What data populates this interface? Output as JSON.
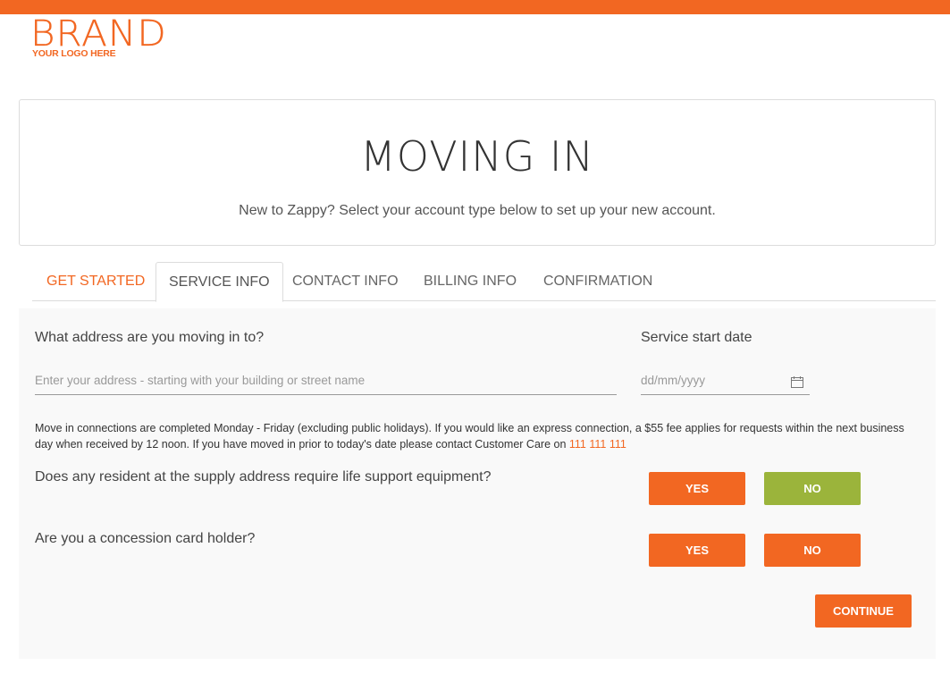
{
  "brand": {
    "name": "BRAND",
    "tagline": "YOUR LOGO HERE",
    "accent_color": "#f26722"
  },
  "hero": {
    "title": "MOVING IN",
    "subtitle": "New to Zappy? Select your account type below to set up your new account."
  },
  "tabs": [
    {
      "label": "GET STARTED",
      "state": "completed"
    },
    {
      "label": "SERVICE INFO",
      "state": "active"
    },
    {
      "label": "CONTACT INFO",
      "state": "pending"
    },
    {
      "label": "BILLING INFO",
      "state": "pending"
    },
    {
      "label": "CONFIRMATION",
      "state": "pending"
    }
  ],
  "form": {
    "address": {
      "label": "What address are you moving in to?",
      "value": "",
      "placeholder": "Enter your address - starting with your building or street name"
    },
    "start_date": {
      "label": "Service start date",
      "value": "",
      "placeholder": "dd/mm/yyyy",
      "icon": "calendar-icon"
    },
    "notice": {
      "text": "Move in connections are completed Monday - Friday (excluding public holidays). If you would like an express connection, a $55 fee applies for requests within the next business day when received by 12 noon. If you have moved in prior to today's date please contact Customer Care on ",
      "phone": "111 111 111"
    },
    "life_support": {
      "question": "Does any resident at the supply address require life support equipment?",
      "yes_label": "YES",
      "no_label": "NO",
      "selected": "NO",
      "selected_color": "#9bb43b"
    },
    "concession": {
      "question": "Are you a concession card holder?",
      "yes_label": "YES",
      "no_label": "NO",
      "selected": null
    },
    "continue_label": "CONTINUE"
  }
}
